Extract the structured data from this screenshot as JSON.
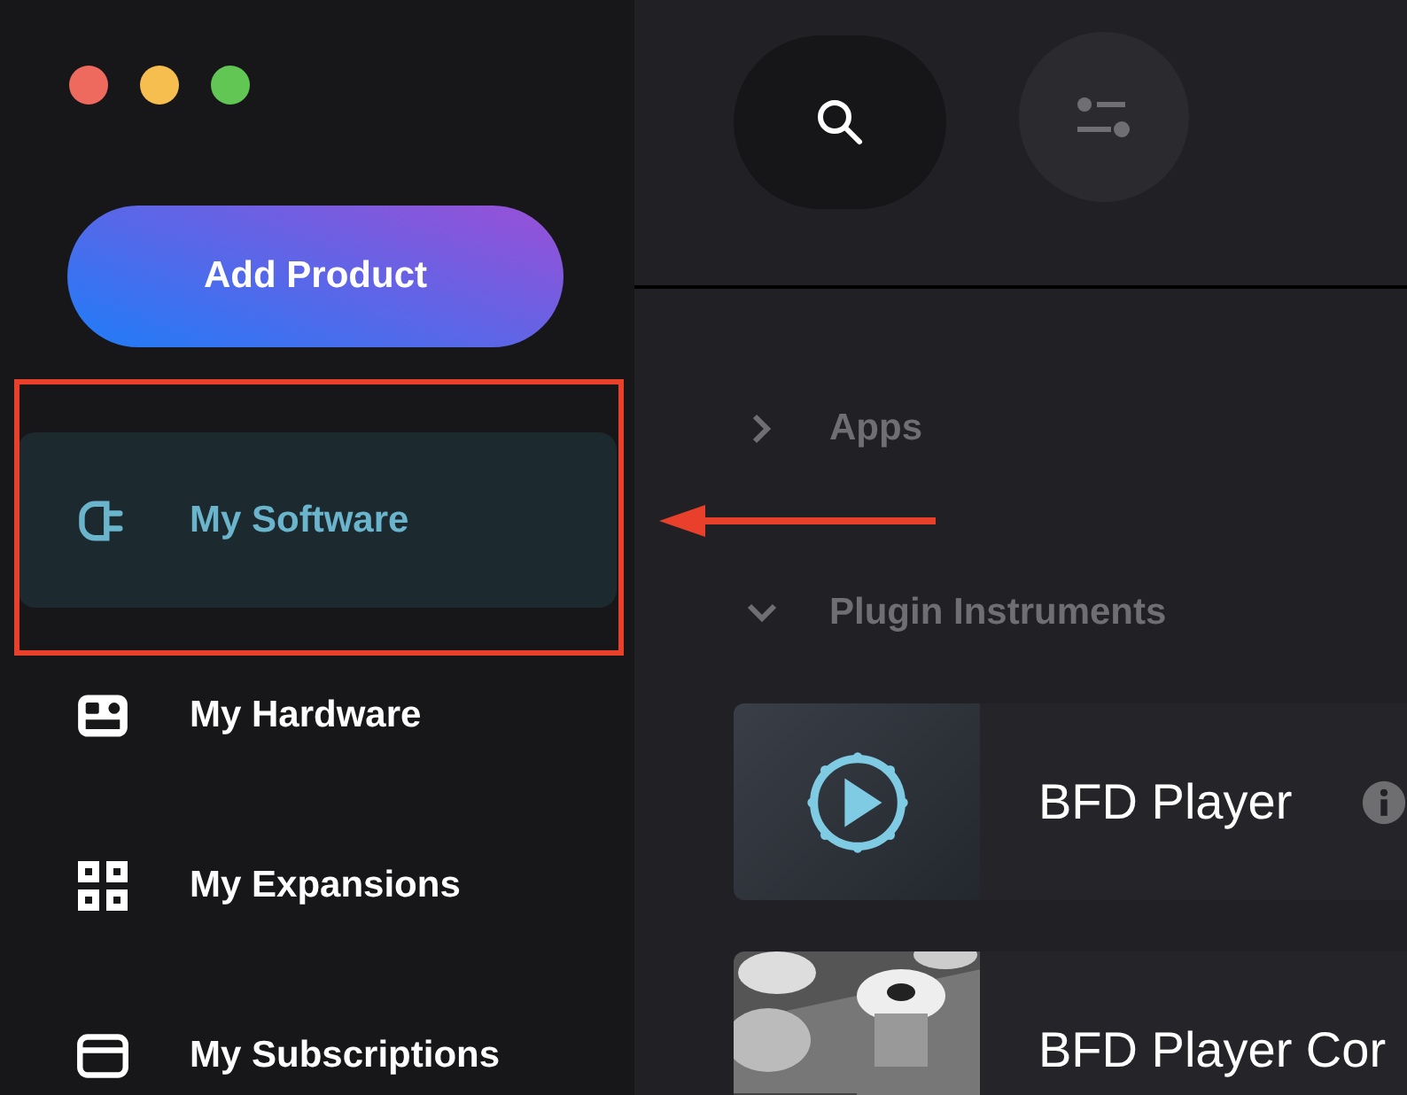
{
  "sidebar": {
    "add_button": "Add Product",
    "items": [
      {
        "label": "My Software",
        "selected": true,
        "kind": "plug"
      },
      {
        "label": "My Hardware",
        "selected": false,
        "kind": "hardware"
      },
      {
        "label": "My Expansions",
        "selected": false,
        "kind": "grid"
      },
      {
        "label": "My Subscriptions",
        "selected": false,
        "kind": "card"
      }
    ]
  },
  "sections": [
    {
      "title": "Apps",
      "expanded": false
    },
    {
      "title": "Plugin Instruments",
      "expanded": true,
      "products": [
        {
          "name": "BFD Player",
          "kind": "logo",
          "info": true
        },
        {
          "name": "BFD Player Cor",
          "kind": "picture",
          "info": false
        }
      ]
    }
  ]
}
